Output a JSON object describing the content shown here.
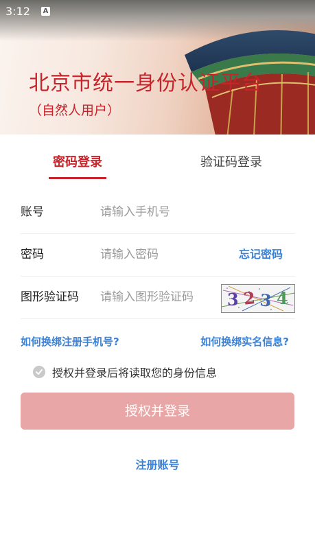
{
  "status_bar": {
    "time": "3:12",
    "notification_icon": "A"
  },
  "header": {
    "title": "北京市统一身份认证平台",
    "subtitle": "（自然人用户）"
  },
  "tabs": [
    {
      "label": "密码登录",
      "active": true
    },
    {
      "label": "验证码登录",
      "active": false
    }
  ],
  "form": {
    "account": {
      "label": "账号",
      "placeholder": "请输入手机号",
      "value": ""
    },
    "password": {
      "label": "密码",
      "placeholder": "请输入密码",
      "value": "",
      "forgot_label": "忘记密码"
    },
    "captcha": {
      "label": "图形验证码",
      "placeholder": "请输入图形验证码",
      "value": "",
      "image_text": "3234"
    }
  },
  "links": {
    "change_phone": "如何换绑注册手机号?",
    "change_realname": "如何换绑实名信息?"
  },
  "consent": {
    "text": "授权并登录后将读取您的身份信息",
    "checked": false
  },
  "login_button": "授权并登录",
  "register_link": "注册账号",
  "colors": {
    "brand_red": "#c8242b",
    "link_blue": "#3b82d6",
    "button_disabled": "#e9a6a6"
  }
}
